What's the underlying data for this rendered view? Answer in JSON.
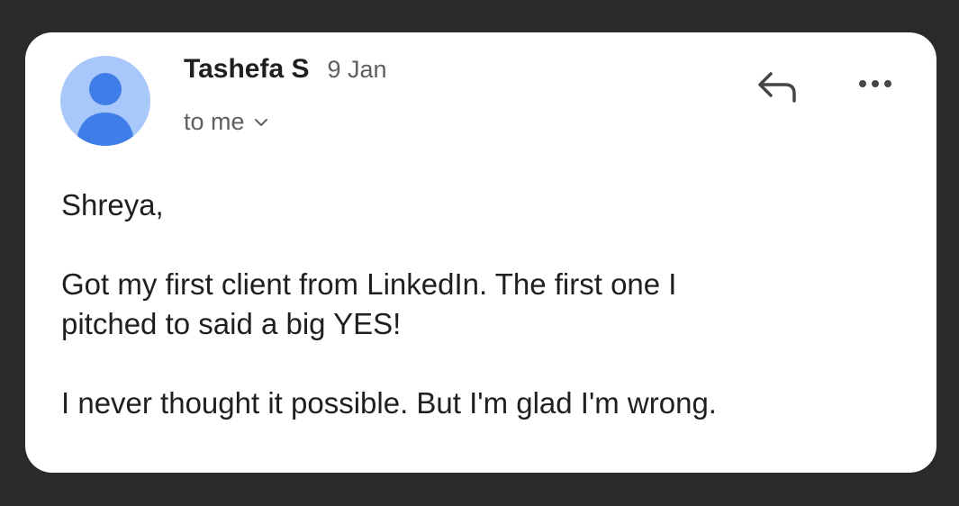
{
  "email": {
    "sender": {
      "name": "Tashefa S",
      "avatar_icon": "person-icon",
      "avatar_color": "#a8c7fa",
      "avatar_figure_color": "#3f7ee8"
    },
    "date": "9 Jan",
    "recipient": "to me",
    "actions": {
      "reply_icon": "reply-icon",
      "more_icon": "more-horizontal-icon"
    },
    "body": {
      "greeting": "Shreya,",
      "paragraphs": [
        "Got my first client from LinkedIn. The first one I\npitched to said a big YES!",
        "I never thought it possible. But I'm glad I'm wrong."
      ]
    }
  },
  "colors": {
    "background": "#2a2a2a",
    "card": "#ffffff",
    "text_primary": "#1f1f1f",
    "text_secondary": "#5f5f5f"
  }
}
